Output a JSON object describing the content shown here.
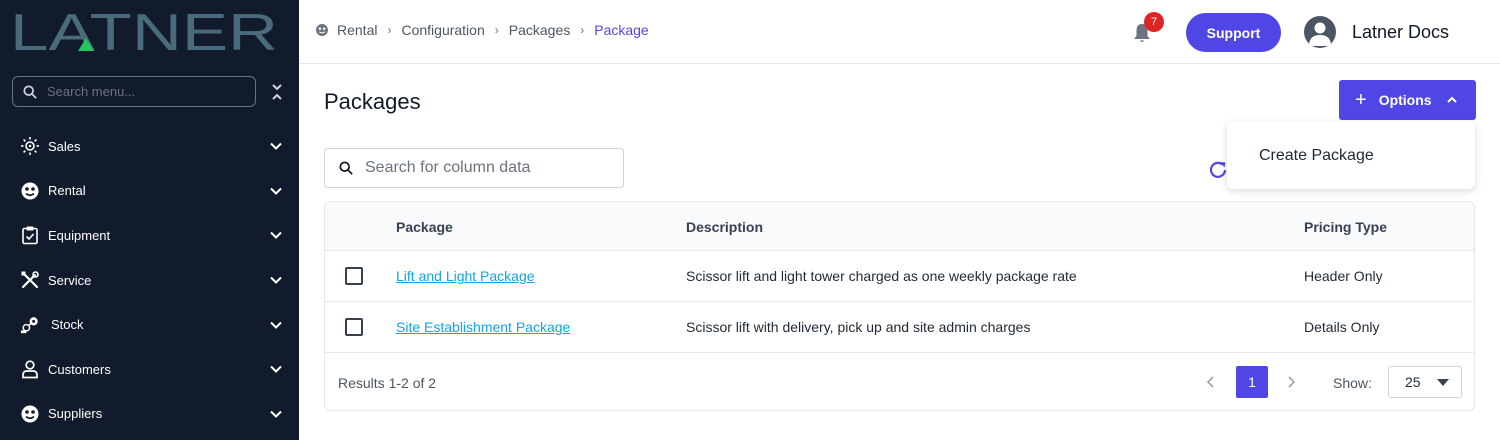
{
  "brand": {
    "logo_text": "LATNER",
    "colors": {
      "sidebar_bg": "#111b2b",
      "accent": "#4f46e5",
      "link": "#0ea5e9",
      "badge": "#dc2626",
      "logo": "#4a6b7a",
      "logo_triangle": "#22c55e"
    }
  },
  "sidebar": {
    "search_placeholder": "Search menu...",
    "items": [
      {
        "label": "Sales",
        "icon": "sun-gear-icon"
      },
      {
        "label": "Rental",
        "icon": "face-icon"
      },
      {
        "label": "Equipment",
        "icon": "clipboard-icon"
      },
      {
        "label": "Service",
        "icon": "tools-icon"
      },
      {
        "label": "Stock",
        "icon": "gears-icon"
      },
      {
        "label": "Customers",
        "icon": "user-icon"
      },
      {
        "label": "Suppliers",
        "icon": "face-icon"
      }
    ]
  },
  "header": {
    "breadcrumb": [
      "Rental",
      "Configuration",
      "Packages",
      "Package"
    ],
    "notification_count": "7",
    "support_label": "Support",
    "user_name": "Latner Docs"
  },
  "main": {
    "title": "Packages",
    "options_label": "Options",
    "dropdown_items": [
      "Create Package"
    ],
    "column_search_placeholder": "Search for column data",
    "table": {
      "headers": [
        "Package",
        "Description",
        "Pricing Type"
      ],
      "rows": [
        {
          "package": "Lift and Light Package",
          "description": "Scissor lift and light tower charged as one weekly package rate",
          "pricing_type": "Header Only"
        },
        {
          "package": "Site Establishment Package",
          "description": "Scissor lift with delivery, pick up and site admin charges",
          "pricing_type": "Details Only"
        }
      ]
    },
    "footer": {
      "results": "Results 1-2 of 2",
      "current_page": "1",
      "show_label": "Show:",
      "page_size": "25"
    }
  }
}
